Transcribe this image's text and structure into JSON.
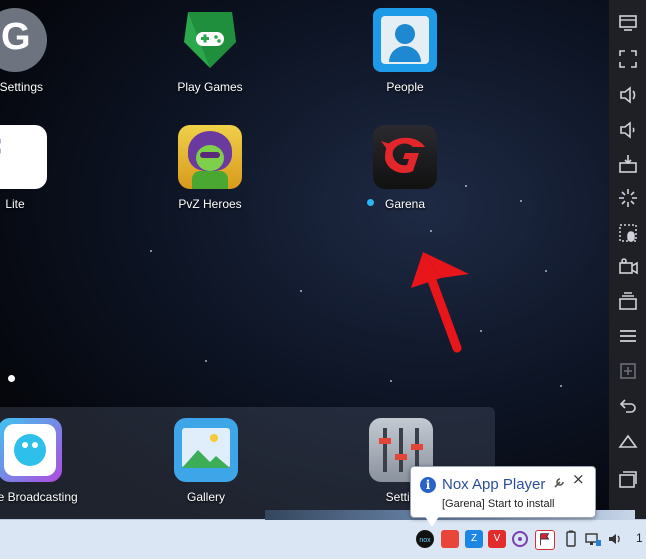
{
  "apps": {
    "google_settings": {
      "label": "le Settings",
      "icon": "gear-g-icon"
    },
    "play_games": {
      "label": "Play Games",
      "icon": "play-games-icon"
    },
    "people": {
      "label": "People",
      "icon": "contacts-icon"
    },
    "facebook_lite": {
      "label": "Lite",
      "icon": "facebook-icon"
    },
    "pvz_heroes": {
      "label": "PvZ Heroes",
      "icon": "pvz-heroes-icon"
    },
    "garena": {
      "label": "Garena",
      "icon": "garena-icon",
      "new_badge_color": "#29b6f6"
    }
  },
  "dock": {
    "live_broadcasting": {
      "label": "Live Broadcasting",
      "icon": "bigo-live-icon"
    },
    "gallery": {
      "label": "Gallery",
      "icon": "gallery-icon"
    },
    "settings": {
      "label": "Settin",
      "icon": "equalizer-settings-icon"
    }
  },
  "sidebar_icons": [
    "monitor-icon",
    "fullscreen-icon",
    "volume-up-icon",
    "volume-down-icon",
    "apk-install-icon",
    "shake-icon",
    "keyboard-mapping-icon",
    "screen-record-icon",
    "multi-instance-icon",
    "menu-icon",
    "add-icon",
    "back-icon",
    "home-icon",
    "recent-apps-icon"
  ],
  "notification": {
    "title": "Nox App Player",
    "message": "[Garena] Start to install",
    "close_label": "×"
  },
  "taskbar": {
    "clock_partial": "1",
    "tray_icons": [
      "nox-tray-icon",
      "red-app-icon",
      "zalo-icon",
      "vivaldi-icon",
      "viber-icon",
      "flag-icon",
      "battery-icon",
      "network-icon",
      "speaker-icon"
    ]
  },
  "colors": {
    "arrow": "#e8151b",
    "sidebar": "#1f2026",
    "taskbar": "#dbe6f5"
  }
}
